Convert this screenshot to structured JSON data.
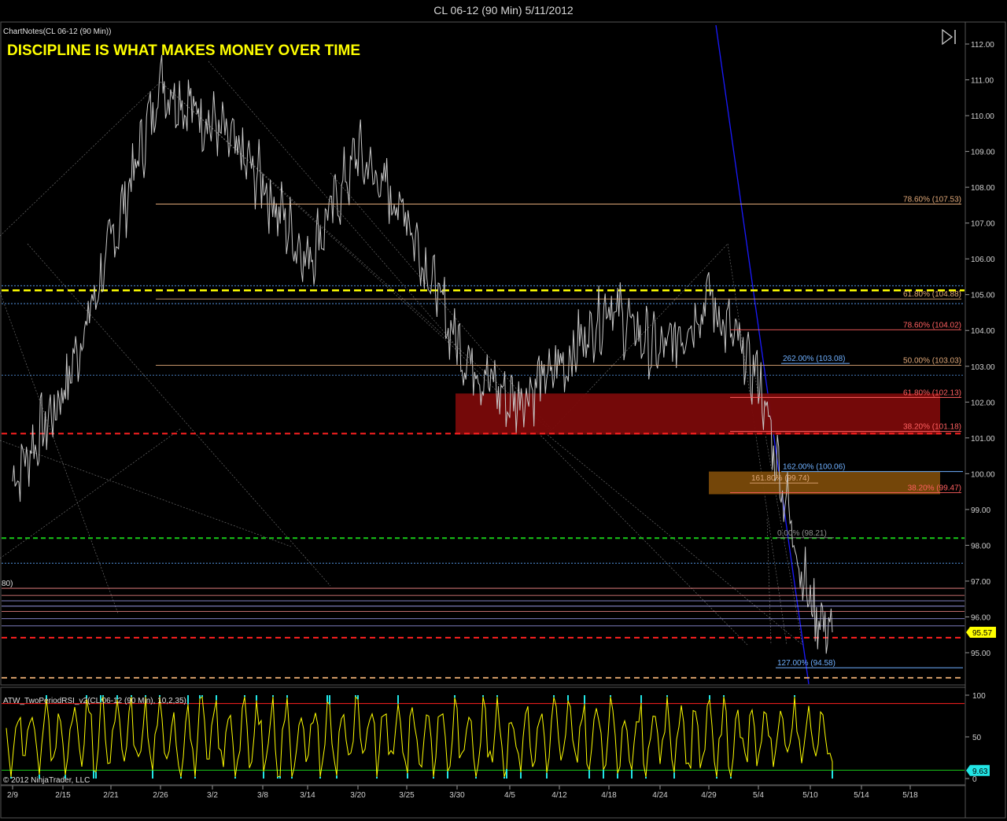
{
  "window_title": "CL 06-12 (90 Min)  5/11/2012",
  "panel_label": "ChartNotes(CL 06-12 (90 Min))",
  "banner": "DISCIPLINE IS WHAT MAKES MONEY OVER TIME",
  "indicator_label": "ATW_TwoPeriodRSI_v2(CL 06-12 (90 Min), 10,2,35)",
  "copyright": "© 2012 NinjaTrader, LLC",
  "left_clip_label": "80)",
  "colors": {
    "price": "#c8c8c8",
    "banner": "#ffff00",
    "support_red": "#ff2020",
    "resistance_yellow": "#ffff00",
    "green_level": "#19c819",
    "fib_orange": "#d9a06a",
    "fib_blue": "#5fa8ff",
    "zone_red": "#7a0a0a",
    "zone_brown": "#7a4a0a",
    "rsi_yellow": "#ffff00",
    "rsi_cyan": "#22e5e5",
    "trendline_blue": "#1a1aff"
  },
  "chart_data": [
    {
      "type": "line",
      "series_name": "CL 06-12 (90 Min)",
      "y_axis": {
        "ticks": [
          "95.00",
          "96.00",
          "97.00",
          "98.00",
          "99.00",
          "100.00",
          "101.00",
          "102.00",
          "103.00",
          "104.00",
          "105.00",
          "106.00",
          "107.00",
          "108.00",
          "109.00",
          "110.00",
          "111.00",
          "112.00"
        ],
        "ylim": [
          94.2,
          112.2
        ]
      },
      "x_axis": {
        "ticks": [
          "2/9",
          "2/15",
          "2/21",
          "2/26",
          "3/2",
          "3/8",
          "3/14",
          "3/20",
          "3/25",
          "3/30",
          "4/5",
          "4/12",
          "4/18",
          "4/24",
          "4/29",
          "5/4",
          "5/10",
          "5/14",
          "5/18"
        ]
      },
      "price_path": [
        [
          "2/9",
          99.8
        ],
        [
          "2/15",
          102.2
        ],
        [
          "2/21",
          106.3
        ],
        [
          "2/26",
          110.9
        ],
        [
          "3/2",
          109.8
        ],
        [
          "3/8",
          108.1
        ],
        [
          "3/14",
          106.0
        ],
        [
          "3/20",
          108.9
        ],
        [
          "3/25",
          107.2
        ],
        [
          "3/30",
          103.6
        ],
        [
          "4/5",
          102.0
        ],
        [
          "4/12",
          102.9
        ],
        [
          "4/18",
          104.7
        ],
        [
          "4/24",
          103.3
        ],
        [
          "4/29",
          104.9
        ],
        [
          "5/4",
          102.6
        ],
        [
          "5/10",
          96.3
        ],
        [
          "5/11",
          95.57
        ]
      ],
      "current_price": "95.57",
      "fib_labels": [
        {
          "text": "78.60% (107.53)",
          "price": 107.53,
          "group": "orange"
        },
        {
          "text": "61.80% (104.88)",
          "price": 104.88,
          "group": "orange"
        },
        {
          "text": "78.60% (104.02)",
          "price": 104.02,
          "group": "red"
        },
        {
          "text": "262.00% (103.08)",
          "price": 103.08,
          "group": "blue"
        },
        {
          "text": "50.00% (103.03)",
          "price": 103.03,
          "group": "orange"
        },
        {
          "text": "61.80% (102.13)",
          "price": 102.13,
          "group": "red"
        },
        {
          "text": "38.20% (101.18)",
          "price": 101.18,
          "group": "red"
        },
        {
          "text": "162.00% (100.06)",
          "price": 100.06,
          "group": "blue"
        },
        {
          "text": "161.80% (99.74)",
          "price": 99.74,
          "group": "orange"
        },
        {
          "text": "38.20% (99.47)",
          "price": 99.47,
          "group": "red"
        },
        {
          "text": "0.00% (98.21)",
          "price": 98.21,
          "group": "gray"
        },
        {
          "text": "127.00% (94.58)",
          "price": 94.58,
          "group": "blue"
        }
      ],
      "levels": [
        {
          "price": 105.12,
          "style": "dashed-yellow"
        },
        {
          "price": 101.12,
          "style": "dashed-red"
        },
        {
          "price": 98.2,
          "style": "dashed-green"
        },
        {
          "price": 95.42,
          "style": "dashed-red"
        },
        {
          "price": 94.3,
          "style": "dashed-orange"
        }
      ],
      "zones": [
        {
          "from": 101.18,
          "to": 102.13,
          "color": "red"
        },
        {
          "from": 99.47,
          "to": 100.06,
          "color": "brown"
        }
      ]
    },
    {
      "type": "line",
      "series_name": "ATW_TwoPeriodRSI_v2",
      "y_axis": {
        "ticks": [
          "100",
          "50",
          "0"
        ],
        "ylim": [
          0,
          100
        ]
      },
      "overbought": 90,
      "oversold": 10,
      "current_value": "9.63"
    }
  ]
}
